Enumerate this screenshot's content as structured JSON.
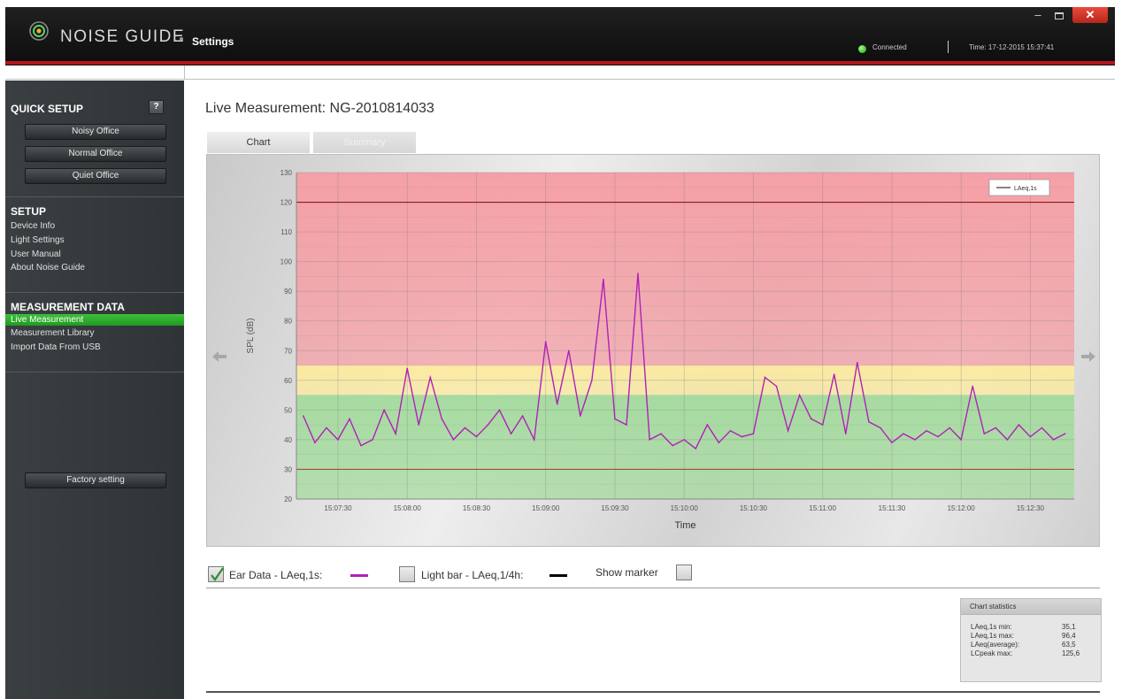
{
  "header": {
    "app_name": "NOISE GUIDE",
    "page_name": "Settings",
    "status": "Connected",
    "time": "Time: 17-12-2015 15:37:41",
    "window_controls": {
      "minimize": "–",
      "close": "✕"
    }
  },
  "sidebar": {
    "quick_setup": {
      "title": "QUICK SETUP",
      "help": "?",
      "buttons": [
        "Noisy Office",
        "Normal Office",
        "Quiet Office"
      ]
    },
    "setup": {
      "title": "SETUP",
      "links": [
        "Device Info",
        "Light Settings",
        "User Manual",
        "About Noise Guide"
      ]
    },
    "measurement_data": {
      "title": "MEASUREMENT DATA",
      "links": [
        "Live Measurement",
        "Measurement Library",
        "Import Data From USB"
      ],
      "active_index": 0
    },
    "factory_button": "Factory setting"
  },
  "main": {
    "title": "Live Measurement: NG-2010814033",
    "tabs": [
      {
        "label": "Chart",
        "active": true
      },
      {
        "label": "Summary",
        "active": false
      }
    ],
    "legend_row": {
      "ear_data": {
        "label": "Ear Data - LAeq,1s:",
        "checked": true,
        "color": "#b020b8"
      },
      "light_bar": {
        "label": "Light bar - LAeq,1/4h:",
        "checked": false,
        "color": "#000000"
      },
      "show_marker": {
        "label": "Show marker",
        "checked": false
      }
    },
    "chart_statistics": {
      "title": "Chart statistics",
      "rows": [
        {
          "label": "LAeq,1s min:",
          "value": "35,1"
        },
        {
          "label": "LAeq,1s max:",
          "value": "96,4"
        },
        {
          "label": "LAeq(average):",
          "value": "63,5"
        },
        {
          "label": "LCpeak max:",
          "value": "125,6"
        }
      ]
    }
  },
  "chart_data": {
    "type": "line",
    "title": "",
    "xlabel": "Time",
    "ylabel": "SPL (dB)",
    "ylim": [
      20,
      130
    ],
    "yticks": [
      20,
      30,
      40,
      50,
      60,
      70,
      80,
      90,
      100,
      110,
      120,
      130
    ],
    "xticks": [
      "15:07:30",
      "15:08:00",
      "15:08:30",
      "15:09:00",
      "15:09:30",
      "15:10:00",
      "15:10:30",
      "15:11:00",
      "15:11:30",
      "15:12:00",
      "15:12:30"
    ],
    "grid": true,
    "legend": {
      "entries": [
        "LAeq,1s"
      ],
      "placement": "top-right"
    },
    "bands": [
      {
        "from": 20,
        "to": 55,
        "color": "#a6dba0"
      },
      {
        "from": 55,
        "to": 65,
        "color": "#fbeaa0"
      },
      {
        "from": 65,
        "to": 130,
        "color": "#f4a0a6"
      }
    ],
    "reference_lines": [
      {
        "value": 120,
        "color": "#8a1b1b"
      },
      {
        "value": 30,
        "color": "#a0522d"
      }
    ],
    "series": [
      {
        "name": "LAeq,1s",
        "color": "#b020b8",
        "x": [
          "15:07:15",
          "15:07:20",
          "15:07:25",
          "15:07:30",
          "15:07:35",
          "15:07:40",
          "15:07:45",
          "15:07:50",
          "15:07:55",
          "15:08:00",
          "15:08:05",
          "15:08:10",
          "15:08:15",
          "15:08:20",
          "15:08:25",
          "15:08:30",
          "15:08:35",
          "15:08:40",
          "15:08:45",
          "15:08:50",
          "15:08:55",
          "15:09:00",
          "15:09:05",
          "15:09:10",
          "15:09:15",
          "15:09:20",
          "15:09:25",
          "15:09:30",
          "15:09:35",
          "15:09:40",
          "15:09:45",
          "15:09:50",
          "15:09:55",
          "15:10:00",
          "15:10:05",
          "15:10:10",
          "15:10:15",
          "15:10:20",
          "15:10:25",
          "15:10:30",
          "15:10:35",
          "15:10:40",
          "15:10:45",
          "15:10:50",
          "15:10:55",
          "15:11:00",
          "15:11:05",
          "15:11:10",
          "15:11:15",
          "15:11:20",
          "15:11:25",
          "15:11:30",
          "15:11:35",
          "15:11:40",
          "15:11:45",
          "15:11:50",
          "15:11:55",
          "15:12:00",
          "15:12:05",
          "15:12:10",
          "15:12:15",
          "15:12:20",
          "15:12:25",
          "15:12:30",
          "15:12:35",
          "15:12:40",
          "15:12:45"
        ],
        "values": [
          48,
          39,
          44,
          40,
          47,
          38,
          40,
          50,
          42,
          64,
          45,
          61,
          47,
          40,
          44,
          41,
          45,
          50,
          42,
          48,
          40,
          73,
          52,
          70,
          48,
          60,
          94,
          47,
          45,
          96,
          40,
          42,
          38,
          40,
          37,
          45,
          39,
          43,
          41,
          42,
          61,
          58,
          43,
          55,
          47,
          45,
          62,
          42,
          66,
          46,
          44,
          39,
          42,
          40,
          43,
          41,
          44,
          40,
          58,
          42,
          44,
          40,
          45,
          41,
          44,
          40,
          42
        ]
      }
    ]
  }
}
